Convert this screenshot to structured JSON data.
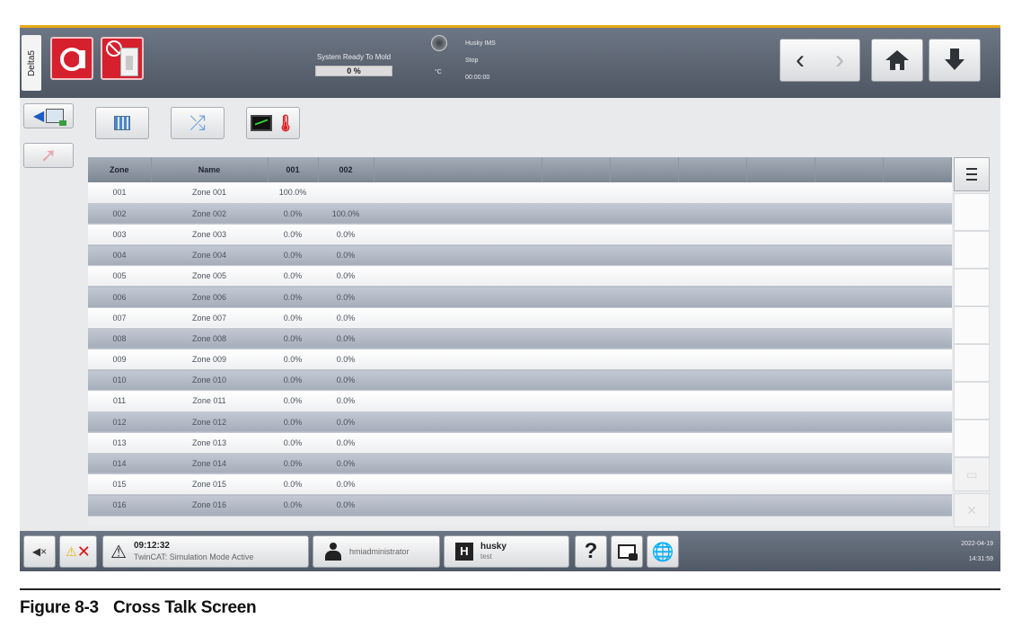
{
  "header": {
    "delta_tab": "Delta5",
    "system_status": "System Ready To Mold",
    "progress_text": "0 %",
    "progress_percent": 0,
    "temp_unit": "°C",
    "ims_title": "Husky IMS",
    "ims_state": "Stop",
    "ims_timer": "00:00:00"
  },
  "table": {
    "columns": [
      "Zone",
      "Name",
      "001",
      "002"
    ],
    "rows": [
      {
        "zone": "001",
        "name": "Zone 001",
        "v1": "100.0%",
        "v2": ""
      },
      {
        "zone": "002",
        "name": "Zone 002",
        "v1": "0.0%",
        "v2": "100.0%"
      },
      {
        "zone": "003",
        "name": "Zone 003",
        "v1": "0.0%",
        "v2": "0.0%"
      },
      {
        "zone": "004",
        "name": "Zone 004",
        "v1": "0.0%",
        "v2": "0.0%"
      },
      {
        "zone": "005",
        "name": "Zone 005",
        "v1": "0.0%",
        "v2": "0.0%"
      },
      {
        "zone": "006",
        "name": "Zone 006",
        "v1": "0.0%",
        "v2": "0.0%"
      },
      {
        "zone": "007",
        "name": "Zone 007",
        "v1": "0.0%",
        "v2": "0.0%"
      },
      {
        "zone": "008",
        "name": "Zone 008",
        "v1": "0.0%",
        "v2": "0.0%"
      },
      {
        "zone": "009",
        "name": "Zone 009",
        "v1": "0.0%",
        "v2": "0.0%"
      },
      {
        "zone": "010",
        "name": "Zone 010",
        "v1": "0.0%",
        "v2": "0.0%"
      },
      {
        "zone": "011",
        "name": "Zone 011",
        "v1": "0.0%",
        "v2": "0.0%"
      },
      {
        "zone": "012",
        "name": "Zone 012",
        "v1": "0.0%",
        "v2": "0.0%"
      },
      {
        "zone": "013",
        "name": "Zone 013",
        "v1": "0.0%",
        "v2": "0.0%"
      },
      {
        "zone": "014",
        "name": "Zone 014",
        "v1": "0.0%",
        "v2": "0.0%"
      },
      {
        "zone": "015",
        "name": "Zone 015",
        "v1": "0.0%",
        "v2": "0.0%"
      },
      {
        "zone": "016",
        "name": "Zone 016",
        "v1": "0.0%",
        "v2": "0.0%"
      }
    ]
  },
  "footer": {
    "message_time": "09:12:32",
    "message_text": "TwinCAT: Simulation Mode Active",
    "user": "hmiadministrator",
    "husky_title": "husky",
    "husky_sub": "test",
    "help": "?",
    "date": "2022-04-19",
    "time": "14:31:59"
  },
  "caption": {
    "figure": "Figure 8-3",
    "title": "Cross Talk Screen"
  },
  "icons": {
    "alarm_ack": "mute-icon",
    "alarm": "alarm-x-icon",
    "warning": "warning-icon",
    "user": "user-icon",
    "help": "help-icon",
    "screenshot": "screenshot-icon",
    "language": "globe-icon",
    "home": "home-icon",
    "download": "down-arrow-icon",
    "menu": "menu-icon"
  },
  "colors": {
    "accent": "#e6a817",
    "alarm_red": "#d6202e",
    "toolbar_dark": "#5a6270",
    "row_alt": "#b4bbc6"
  }
}
